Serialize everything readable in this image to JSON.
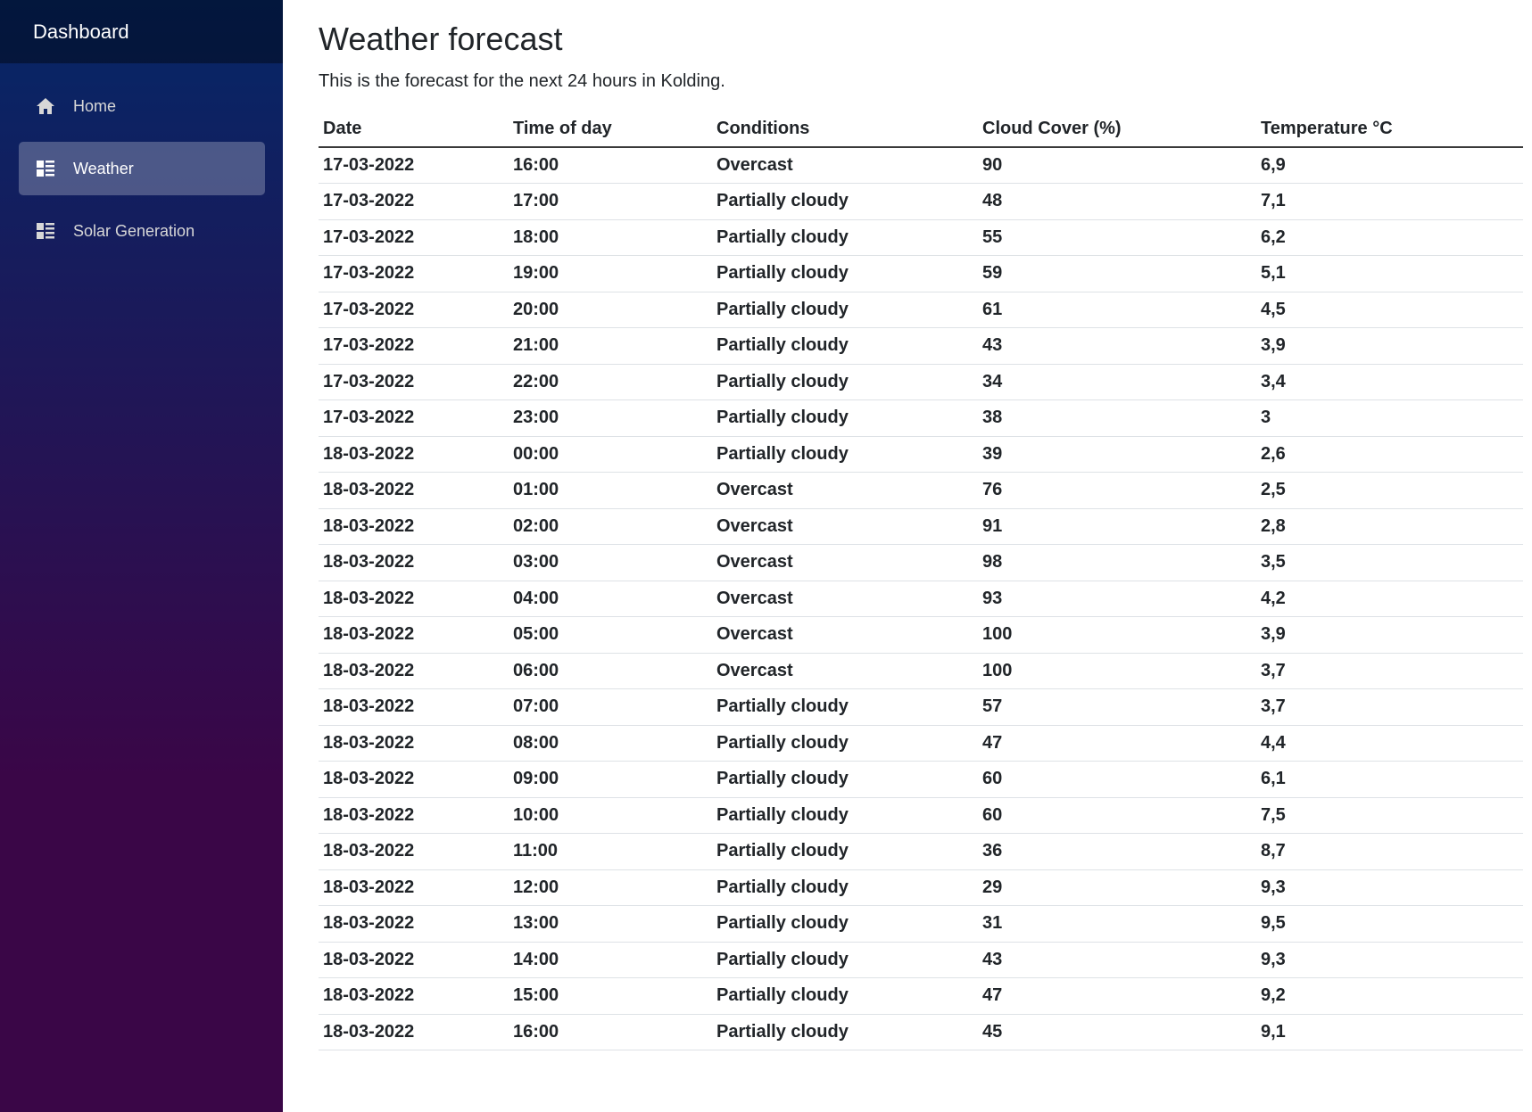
{
  "sidebar": {
    "brand": "Dashboard",
    "items": [
      {
        "label": "Home",
        "icon": "home-icon",
        "active": false
      },
      {
        "label": "Weather",
        "icon": "list-icon",
        "active": true
      },
      {
        "label": "Solar Generation",
        "icon": "list-icon",
        "active": false
      }
    ]
  },
  "main": {
    "title": "Weather forecast",
    "intro": "This is the forecast for the next 24 hours in Kolding.",
    "table": {
      "headers": [
        "Date",
        "Time of day",
        "Conditions",
        "Cloud Cover (%)",
        "Temperature °C"
      ],
      "rows": [
        [
          "17-03-2022",
          "16:00",
          "Overcast",
          "90",
          "6,9"
        ],
        [
          "17-03-2022",
          "17:00",
          "Partially cloudy",
          "48",
          "7,1"
        ],
        [
          "17-03-2022",
          "18:00",
          "Partially cloudy",
          "55",
          "6,2"
        ],
        [
          "17-03-2022",
          "19:00",
          "Partially cloudy",
          "59",
          "5,1"
        ],
        [
          "17-03-2022",
          "20:00",
          "Partially cloudy",
          "61",
          "4,5"
        ],
        [
          "17-03-2022",
          "21:00",
          "Partially cloudy",
          "43",
          "3,9"
        ],
        [
          "17-03-2022",
          "22:00",
          "Partially cloudy",
          "34",
          "3,4"
        ],
        [
          "17-03-2022",
          "23:00",
          "Partially cloudy",
          "38",
          "3"
        ],
        [
          "18-03-2022",
          "00:00",
          "Partially cloudy",
          "39",
          "2,6"
        ],
        [
          "18-03-2022",
          "01:00",
          "Overcast",
          "76",
          "2,5"
        ],
        [
          "18-03-2022",
          "02:00",
          "Overcast",
          "91",
          "2,8"
        ],
        [
          "18-03-2022",
          "03:00",
          "Overcast",
          "98",
          "3,5"
        ],
        [
          "18-03-2022",
          "04:00",
          "Overcast",
          "93",
          "4,2"
        ],
        [
          "18-03-2022",
          "05:00",
          "Overcast",
          "100",
          "3,9"
        ],
        [
          "18-03-2022",
          "06:00",
          "Overcast",
          "100",
          "3,7"
        ],
        [
          "18-03-2022",
          "07:00",
          "Partially cloudy",
          "57",
          "3,7"
        ],
        [
          "18-03-2022",
          "08:00",
          "Partially cloudy",
          "47",
          "4,4"
        ],
        [
          "18-03-2022",
          "09:00",
          "Partially cloudy",
          "60",
          "6,1"
        ],
        [
          "18-03-2022",
          "10:00",
          "Partially cloudy",
          "60",
          "7,5"
        ],
        [
          "18-03-2022",
          "11:00",
          "Partially cloudy",
          "36",
          "8,7"
        ],
        [
          "18-03-2022",
          "12:00",
          "Partially cloudy",
          "29",
          "9,3"
        ],
        [
          "18-03-2022",
          "13:00",
          "Partially cloudy",
          "31",
          "9,5"
        ],
        [
          "18-03-2022",
          "14:00",
          "Partially cloudy",
          "43",
          "9,3"
        ],
        [
          "18-03-2022",
          "15:00",
          "Partially cloudy",
          "47",
          "9,2"
        ],
        [
          "18-03-2022",
          "16:00",
          "Partially cloudy",
          "45",
          "9,1"
        ]
      ]
    }
  },
  "colors": {
    "sidebar_top": "#052767",
    "sidebar_bottom": "#3a0647",
    "active_item_bg": "rgba(255,255,255,0.25)",
    "text": "#212529"
  }
}
